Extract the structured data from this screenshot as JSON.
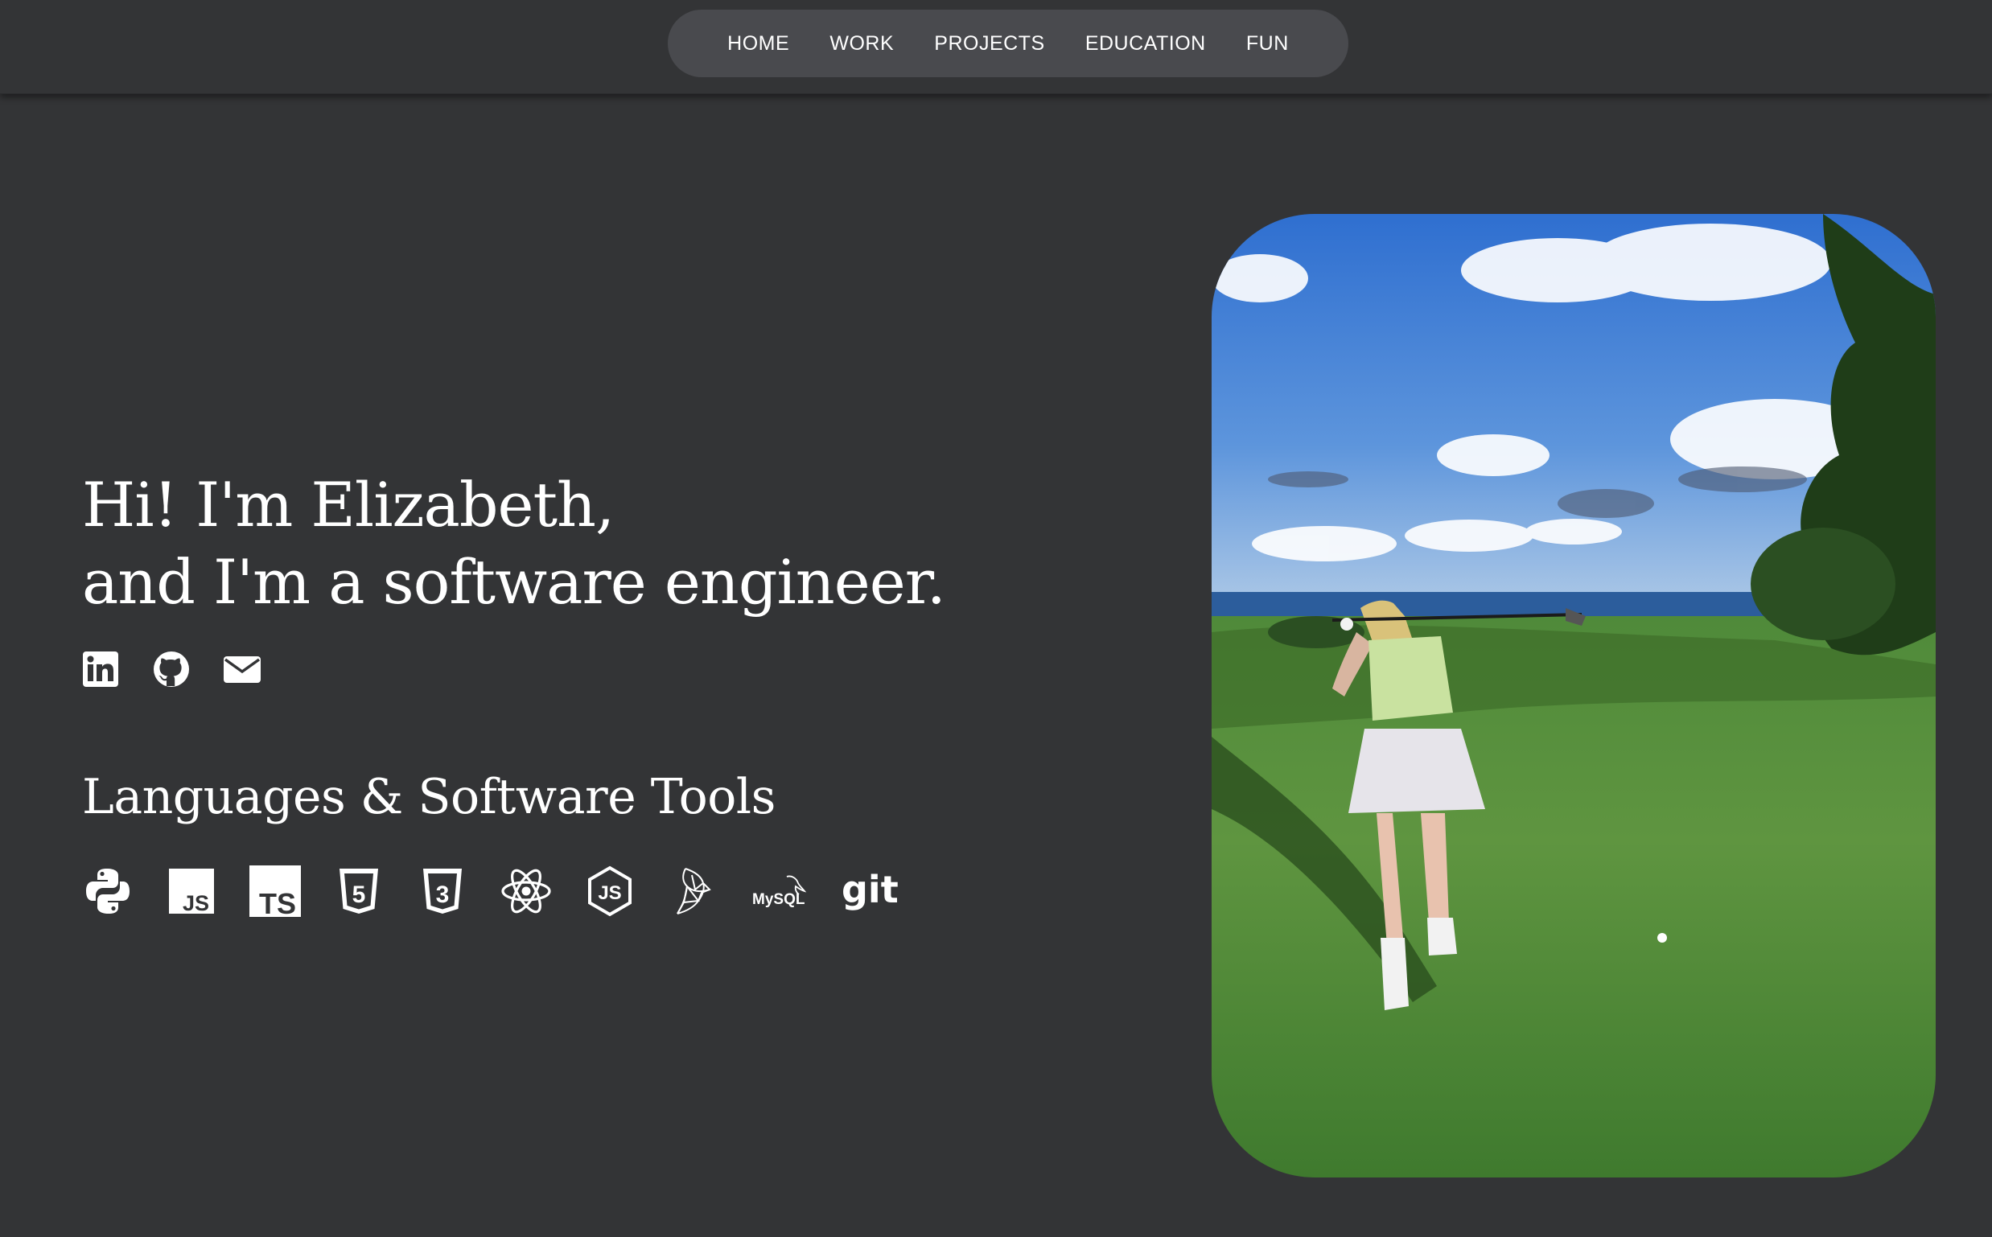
{
  "nav": {
    "items": [
      {
        "label": "HOME"
      },
      {
        "label": "WORK"
      },
      {
        "label": "PROJECTS"
      },
      {
        "label": "EDUCATION"
      },
      {
        "label": "FUN"
      }
    ]
  },
  "hero": {
    "line1": "Hi! I'm Elizabeth,",
    "line2": "and I'm a software engineer."
  },
  "socials": [
    "linkedin-icon",
    "github-icon",
    "mail-icon"
  ],
  "skills": {
    "title": "Languages & Software Tools",
    "icons": [
      {
        "name": "python-icon"
      },
      {
        "name": "javascript-icon",
        "text": "JS"
      },
      {
        "name": "typescript-icon",
        "text": "TS"
      },
      {
        "name": "html5-icon",
        "text": "5"
      },
      {
        "name": "css3-icon",
        "text": "3"
      },
      {
        "name": "react-icon"
      },
      {
        "name": "nodejs-icon",
        "text": "JS"
      },
      {
        "name": "sql-server-icon"
      },
      {
        "name": "mysql-icon",
        "text": "MySQL"
      },
      {
        "name": "git-icon",
        "text": "git"
      }
    ]
  },
  "colors": {
    "background": "#333436",
    "nav_pill": "#494a4e",
    "text": "#ffffff"
  }
}
